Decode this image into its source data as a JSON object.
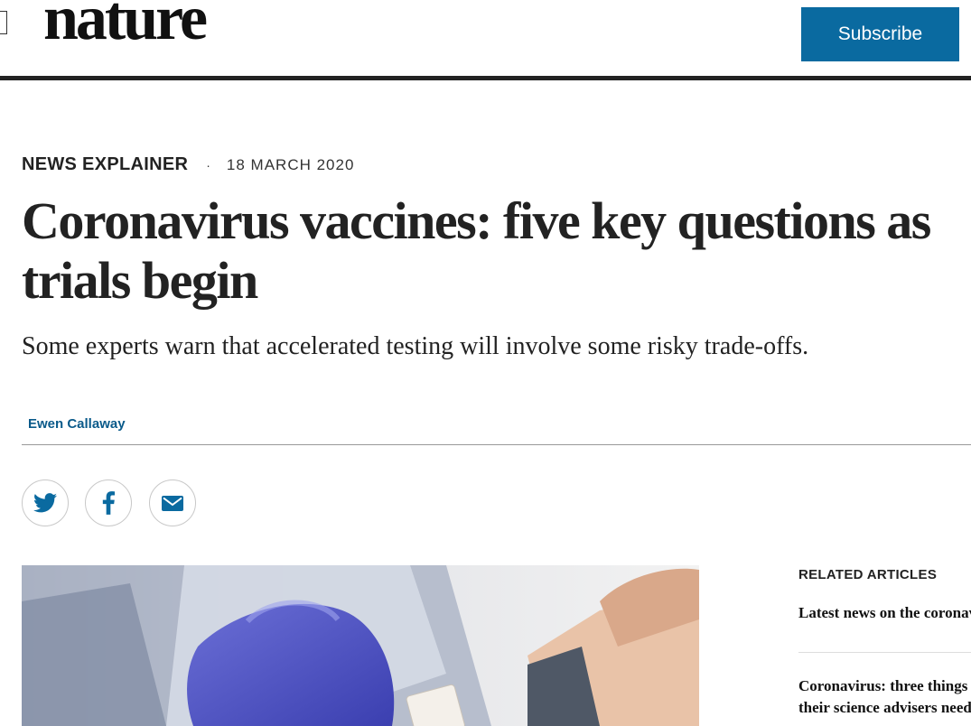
{
  "header": {
    "logo": "nature",
    "subscribe_label": "Subscribe"
  },
  "article": {
    "type": "NEWS EXPLAINER",
    "separator": "·",
    "date": "18 MARCH 2020",
    "title": "Coronavirus vaccines: five key questions as trials begin",
    "standfirst": "Some experts warn that accelerated testing will involve some risky trade-offs.",
    "author": "Ewen Callaway"
  },
  "share": {
    "icons": [
      "twitter-icon",
      "facebook-icon",
      "email-icon"
    ]
  },
  "related": {
    "heading": "RELATED ARTICLES",
    "items": [
      {
        "line1": "Latest news on the coronavirus"
      },
      {
        "line1": "Coronavirus: three things",
        "line2": "their science advisers need"
      }
    ]
  },
  "colors": {
    "accent": "#0a6aa0",
    "author_link": "#0a5a8a",
    "text": "#222222"
  }
}
